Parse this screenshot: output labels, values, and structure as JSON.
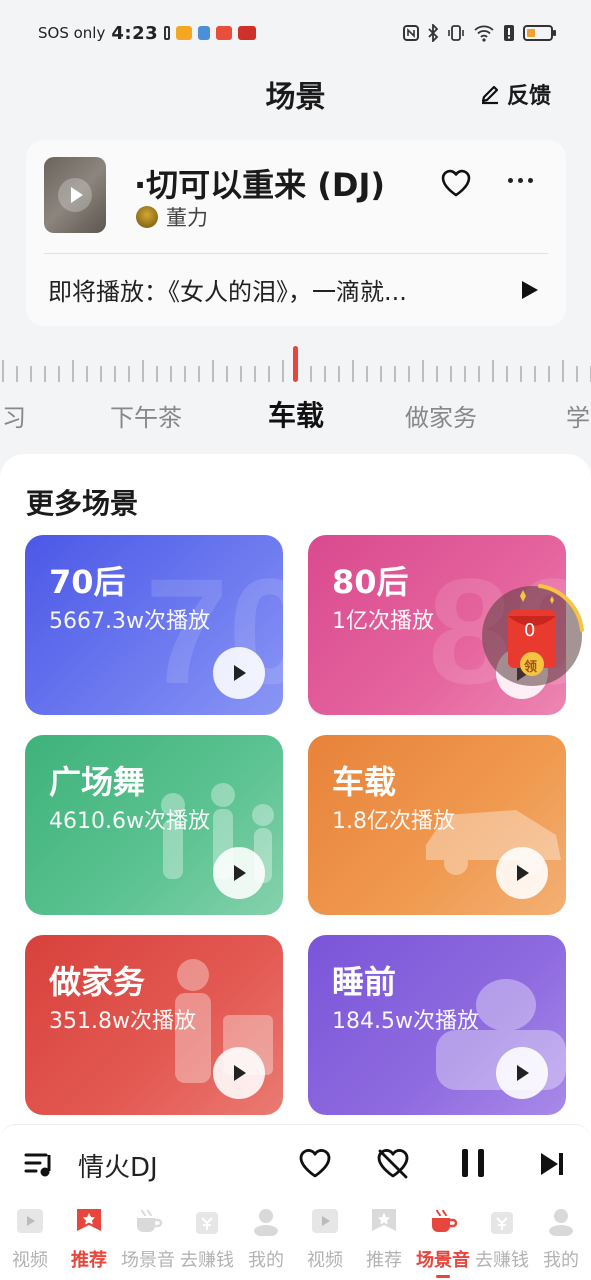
{
  "status_bar": {
    "sos": "SOS only",
    "time": "4:23"
  },
  "header": {
    "title": "场景",
    "feedback": "反馈"
  },
  "now_playing": {
    "title": "·切可以重来 (DJ)",
    "artist": "董力",
    "next_up": "即将播放：《女人的泪》，一滴就..."
  },
  "scene_tabs": [
    "习",
    "下午茶",
    "车载",
    "做家务",
    "学"
  ],
  "scene_tabs_active_index": 2,
  "section_title": "更多场景",
  "scene_cards": [
    {
      "title": "70后",
      "plays": "5667.3w次播放",
      "bg_text": "70"
    },
    {
      "title": "80后",
      "plays": "1亿次播放",
      "bg_text": "80"
    },
    {
      "title": "广场舞",
      "plays": "4610.6w次播放"
    },
    {
      "title": "车载",
      "plays": "1.8亿次播放"
    },
    {
      "title": "做家务",
      "plays": "351.8w次播放"
    },
    {
      "title": "睡前",
      "plays": "184.5w次播放"
    }
  ],
  "red_packet": {
    "count": "0",
    "label": "领"
  },
  "mini_player": {
    "song": "情火DJ"
  },
  "bottom_nav": [
    {
      "label": "视频",
      "icon": "video-icon"
    },
    {
      "label": "推荐",
      "icon": "recommend-icon"
    },
    {
      "label": "场景音",
      "icon": "coffee-cup-icon"
    },
    {
      "label": "去赚钱",
      "icon": "money-bag-icon"
    },
    {
      "label": "我的",
      "icon": "profile-icon"
    },
    {
      "label": "视频",
      "icon": "video-icon"
    },
    {
      "label": "推荐",
      "icon": "recommend-icon"
    },
    {
      "label": "场景音",
      "icon": "coffee-cup-icon"
    },
    {
      "label": "去赚钱",
      "icon": "money-bag-icon"
    },
    {
      "label": "我的",
      "icon": "profile-icon"
    }
  ],
  "colors": {
    "accent": "#e8453c",
    "card_70": "#4b58e6",
    "card_80": "#d94a8e",
    "card_guangchangwu": "#3fb27a",
    "card_car": "#e8823a",
    "card_housework": "#d8413c",
    "card_sleep": "#7a55d8"
  }
}
